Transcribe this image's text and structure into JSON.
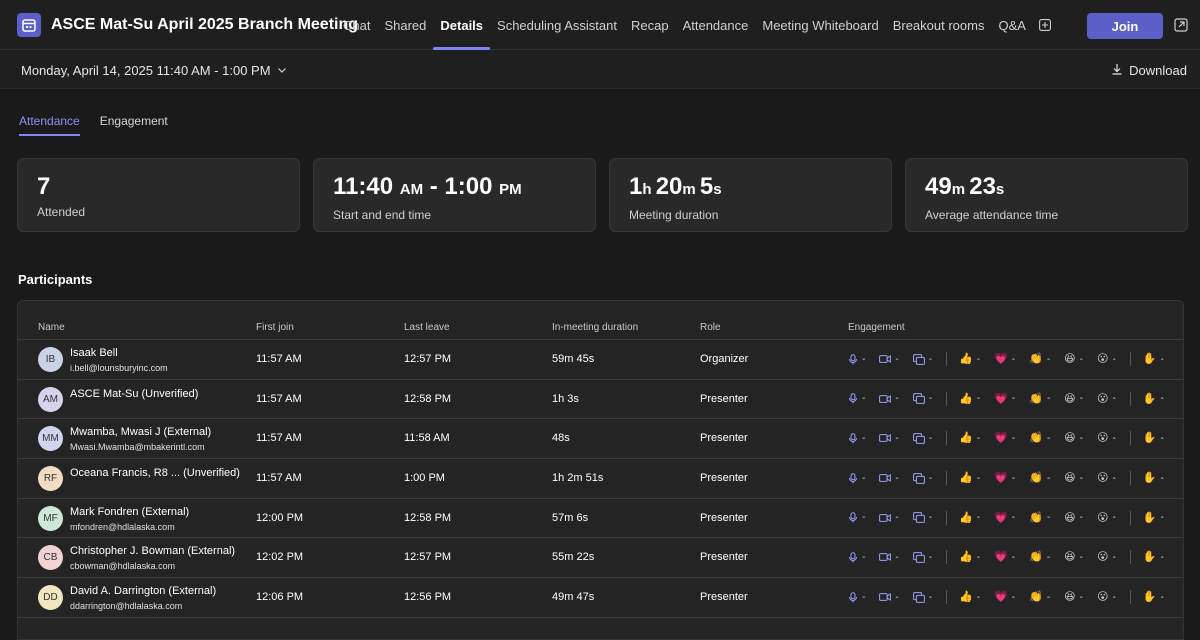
{
  "header": {
    "title": "ASCE Mat-Su April 2025 Branch Meeting",
    "tabs": [
      {
        "label": "Chat",
        "active": false
      },
      {
        "label": "Shared",
        "active": false
      },
      {
        "label": "Details",
        "active": true
      },
      {
        "label": "Scheduling Assistant",
        "active": false
      },
      {
        "label": "Recap",
        "active": false
      },
      {
        "label": "Attendance",
        "active": false
      },
      {
        "label": "Meeting Whiteboard",
        "active": false
      },
      {
        "label": "Breakout rooms",
        "active": false
      },
      {
        "label": "Q&A",
        "active": false
      }
    ],
    "join_label": "Join",
    "accent": "#5b5fc7"
  },
  "datebar": {
    "date_label": "Monday, April 14, 2025 11:40 AM - 1:00 PM",
    "download_label": "Download"
  },
  "subtabs": [
    {
      "label": "Attendance",
      "active": true
    },
    {
      "label": "Engagement",
      "active": false
    }
  ],
  "cards": [
    {
      "parts": [
        {
          "t": "7",
          "u": false
        }
      ],
      "label": "Attended"
    },
    {
      "parts": [
        {
          "t": "11:40 ",
          "u": false
        },
        {
          "t": "AM",
          "u": true
        },
        {
          "t": " - 1:00 ",
          "u": false
        },
        {
          "t": "PM",
          "u": true
        }
      ],
      "label": "Start and end time"
    },
    {
      "parts": [
        {
          "t": "1",
          "u": false
        },
        {
          "t": "h ",
          "u": true
        },
        {
          "t": "20",
          "u": false
        },
        {
          "t": "m ",
          "u": true
        },
        {
          "t": "5",
          "u": false
        },
        {
          "t": "s",
          "u": true
        }
      ],
      "label": "Meeting duration"
    },
    {
      "parts": [
        {
          "t": "49",
          "u": false
        },
        {
          "t": "m ",
          "u": true
        },
        {
          "t": "23",
          "u": false
        },
        {
          "t": "s",
          "u": true
        }
      ],
      "label": "Average attendance time"
    }
  ],
  "participants": {
    "title": "Participants",
    "columns": [
      "Name",
      "First join",
      "Last leave",
      "In-meeting duration",
      "Role",
      "Engagement"
    ],
    "engagement_placeholder": "-",
    "rows": [
      {
        "initials": "IB",
        "avatar_color": "#c9d3e6",
        "name": "Isaak Bell",
        "email": "i.bell@lounsburyinc.com",
        "first_join": "11:57 AM",
        "last_leave": "12:57 PM",
        "duration": "59m 45s",
        "role": "Organizer"
      },
      {
        "initials": "AM",
        "avatar_color": "#d8d2ec",
        "name": "ASCE Mat-Su (Unverified)",
        "email": "",
        "first_join": "11:57 AM",
        "last_leave": "12:58 PM",
        "duration": "1h 3s",
        "role": "Presenter"
      },
      {
        "initials": "MM",
        "avatar_color": "#cdd6ee",
        "name": "Mwamba, Mwasi J (External)",
        "email": "Mwasi.Mwamba@mbakerintl.com",
        "first_join": "11:57 AM",
        "last_leave": "11:58 AM",
        "duration": "48s",
        "role": "Presenter"
      },
      {
        "initials": "RF",
        "avatar_color": "#f3dcc4",
        "name": "Oceana Francis, R8 ... (Unverified)",
        "email": "",
        "first_join": "11:57 AM",
        "last_leave": "1:00 PM",
        "duration": "1h 2m 51s",
        "role": "Presenter"
      },
      {
        "initials": "MF",
        "avatar_color": "#cfe8d6",
        "name": "Mark Fondren (External)",
        "email": "mfondren@hdlalaska.com",
        "first_join": "12:00 PM",
        "last_leave": "12:58 PM",
        "duration": "57m 6s",
        "role": "Presenter"
      },
      {
        "initials": "CB",
        "avatar_color": "#f1d3d3",
        "name": "Christopher J. Bowman (External)",
        "email": "cbowman@hdlalaska.com",
        "first_join": "12:02 PM",
        "last_leave": "12:57 PM",
        "duration": "55m 22s",
        "role": "Presenter"
      },
      {
        "initials": "DD",
        "avatar_color": "#f0e6bf",
        "name": "David A. Darrington (External)",
        "email": "ddarrington@hdlalaska.com",
        "first_join": "12:06 PM",
        "last_leave": "12:56 PM",
        "duration": "49m 47s",
        "role": "Presenter"
      }
    ]
  },
  "icons": {
    "engagement": [
      "mic-icon",
      "camera-icon",
      "screen-share-icon",
      "thumbs-up-icon",
      "heart-icon",
      "clap-icon",
      "laugh-icon",
      "surprised-icon",
      "raise-hand-icon"
    ]
  }
}
